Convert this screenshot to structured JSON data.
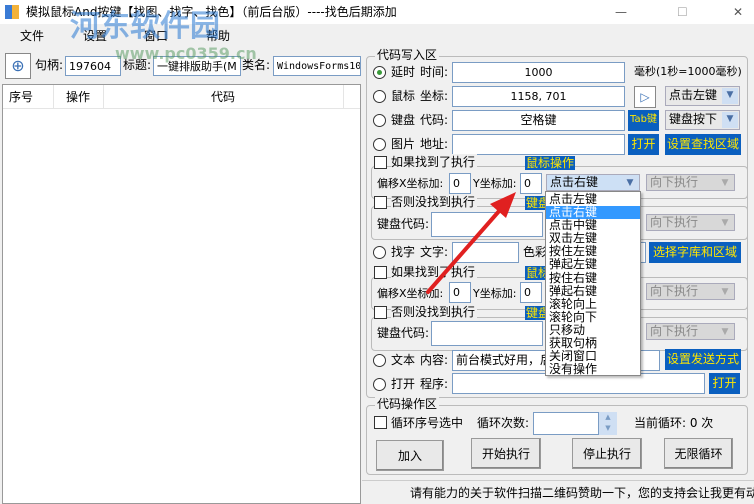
{
  "window": {
    "title": "模拟鼠标And按键【找图、找字、找色】（前后台版）----找色后期添加",
    "minimize": "—",
    "maximize": "☐",
    "close": "✕"
  },
  "watermark": {
    "text": "河东软件园",
    "url": "www.pc0359.cn"
  },
  "menu": [
    "文件",
    "设置",
    "窗口",
    "帮助"
  ],
  "toolbar": {
    "handle_label": "句柄:",
    "handle_value": "197604",
    "title_label": "标题:",
    "title_value": "一键排版助手(M",
    "class_label": "类名:",
    "class_value": "WindowsForms10"
  },
  "list": {
    "columns": [
      "序号",
      "操作",
      "代码"
    ],
    "rows": []
  },
  "code_write": {
    "group_title": "代码写入区",
    "delay": {
      "label": "延时",
      "field": "时间:",
      "value": "1000",
      "note": "毫秒(1秒=1000毫秒)",
      "selected": true
    },
    "mouse": {
      "label": "鼠标",
      "field": "坐标:",
      "value": "1158, 701",
      "action": "点击左键"
    },
    "keyboard": {
      "label": "键盘",
      "field": "代码:",
      "value": "空格键",
      "tab_button": "Tab键",
      "action": "键盘按下"
    },
    "image": {
      "label": "图片",
      "field": "地址:",
      "value": "",
      "open_button": "打开",
      "area_button": "设置查找区域"
    },
    "img_found": {
      "label": "如果找到了执行",
      "tag": "鼠标操作",
      "offset_x_label": "偏移X坐标加:",
      "offset_x": "0",
      "offset_y_label": "Y坐标加:",
      "offset_y": "0",
      "action": "点击右键",
      "next": "向下执行"
    },
    "img_notfound": {
      "label": "否则没找到执行",
      "tag": "键盘",
      "key_label": "键盘代码:",
      "key_value": "",
      "next": "向下执行"
    },
    "text_find": {
      "label": "找字",
      "field": "文字:",
      "value": "",
      "color_label": "色彩",
      "button": "选择字库和区域"
    },
    "txt_found": {
      "label": "如果找到了执行",
      "tag": "鼠标",
      "offset_x_label": "偏移X坐标加:",
      "offset_x": "0",
      "offset_y_label": "Y坐标加:",
      "offset_y": "0",
      "next": "向下执行"
    },
    "txt_notfound": {
      "label": "否则没找到执行",
      "tag": "键盘",
      "key_label": "键盘代码:",
      "key_value": "",
      "next": "向下执行"
    },
    "text_send": {
      "label": "文本",
      "field": "内容:",
      "value": "前台模式好用，后",
      "button": "设置发送方式"
    },
    "open_prog": {
      "label": "打开",
      "field": "程序:",
      "value": "",
      "button": "打开"
    }
  },
  "dropdown_options": [
    "点击左键",
    "点击右键",
    "点击中键",
    "双击左键",
    "按住左键",
    "弹起左键",
    "按住右键",
    "弹起右键",
    "滚轮向上",
    "滚轮向下",
    "只移动",
    "获取句柄",
    "关闭窗口",
    "没有操作"
  ],
  "dropdown_selected": 1,
  "code_ops": {
    "group_title": "代码操作区",
    "loop_select": "循环序号选中",
    "loop_count_label": "循环次数:",
    "loop_count": "",
    "current_loop": "当前循环: 0 次",
    "buttons": [
      "加入",
      "开始执行",
      "停止执行",
      "无限循环"
    ]
  },
  "status": "请有能力的关于软件扫描二维码赞助一下，您的支持会让我更有动",
  "colors": {
    "accent_blue": "#0a5fbf",
    "accent_yellow": "#ffe600",
    "arrow_red": "#e02020"
  }
}
